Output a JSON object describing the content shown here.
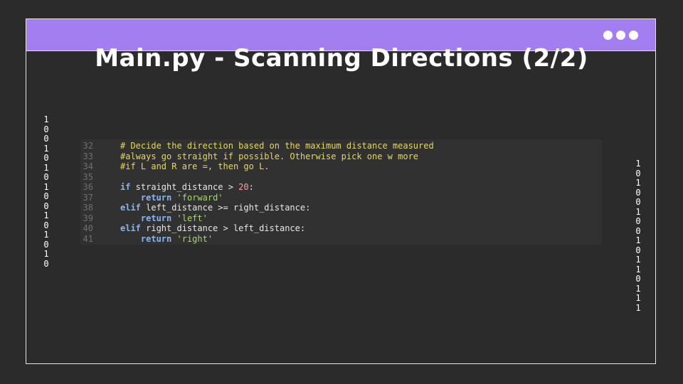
{
  "header": {
    "menu_icon": "more-dots-icon",
    "accent_color": "#a37ef0"
  },
  "title": "Main.py - Scanning Directions (2/2)",
  "binary_left": [
    "1",
    "0",
    "0",
    "1",
    "0",
    "1",
    "0",
    "1",
    "0",
    "0",
    "1",
    "0",
    "1",
    "0",
    "1",
    "0"
  ],
  "binary_right": [
    "1",
    "0",
    "1",
    "0",
    "0",
    "1",
    "0",
    "0",
    "1",
    "0",
    "1",
    "1",
    "0",
    "1",
    "1",
    "1"
  ],
  "code": {
    "lines": [
      {
        "num": "32",
        "tokens": [
          {
            "t": "# Decide the direction based on the maximum distance measured",
            "c": "comment"
          }
        ]
      },
      {
        "num": "33",
        "tokens": [
          {
            "t": "#always go straight if possible. Otherwise pick one w more",
            "c": "comment"
          }
        ]
      },
      {
        "num": "34",
        "tokens": [
          {
            "t": "#if L and R are =, then go L.",
            "c": "comment"
          }
        ]
      },
      {
        "num": "35",
        "tokens": []
      },
      {
        "num": "36",
        "tokens": [
          {
            "t": "if",
            "c": "kw"
          },
          {
            "t": " straight_distance > ",
            "c": "plain"
          },
          {
            "t": "20",
            "c": "num"
          },
          {
            "t": ":",
            "c": "plain"
          }
        ]
      },
      {
        "num": "37",
        "tokens": [
          {
            "t": "    ",
            "c": "plain"
          },
          {
            "t": "return",
            "c": "kw"
          },
          {
            "t": " ",
            "c": "plain"
          },
          {
            "t": "'forward'",
            "c": "str"
          }
        ]
      },
      {
        "num": "38",
        "tokens": [
          {
            "t": "elif",
            "c": "kw"
          },
          {
            "t": " left_distance >= right_distance:",
            "c": "plain"
          }
        ]
      },
      {
        "num": "39",
        "tokens": [
          {
            "t": "    ",
            "c": "plain"
          },
          {
            "t": "return",
            "c": "kw"
          },
          {
            "t": " ",
            "c": "plain"
          },
          {
            "t": "'left'",
            "c": "str"
          }
        ]
      },
      {
        "num": "40",
        "tokens": [
          {
            "t": "elif",
            "c": "kw"
          },
          {
            "t": " right_distance > left_distance:",
            "c": "plain"
          }
        ]
      },
      {
        "num": "41",
        "tokens": [
          {
            "t": "    ",
            "c": "plain"
          },
          {
            "t": "return",
            "c": "kw"
          },
          {
            "t": " ",
            "c": "plain"
          },
          {
            "t": "'right'",
            "c": "str"
          }
        ]
      }
    ]
  }
}
